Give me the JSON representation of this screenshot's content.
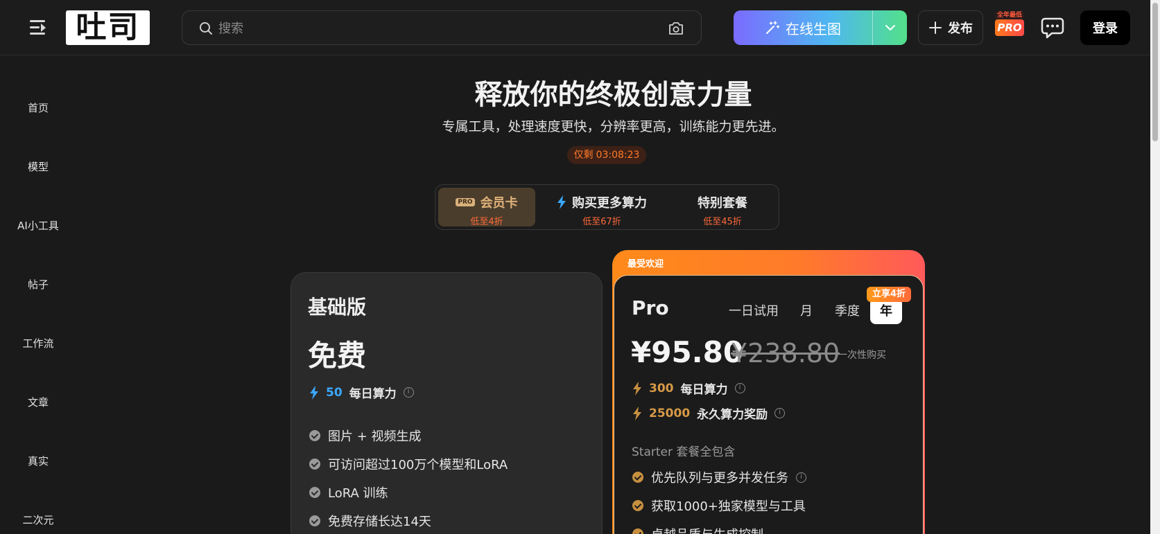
{
  "header": {
    "logo_text": "吐司",
    "search_placeholder": "搜索",
    "gen_button_label": "在线生图",
    "publish_label": "发布",
    "pro_badge_top": "全年最低",
    "pro_badge_label": "PRO",
    "login_label": "登录"
  },
  "sidebar": {
    "items": [
      "首页",
      "模型",
      "AI小工具",
      "帖子",
      "工作流",
      "文章",
      "真实",
      "二次元"
    ]
  },
  "hero": {
    "title": "释放你的终极创意力量",
    "subtitle": "专属工具，处理速度更快，分辨率更高，训练能力更先进。",
    "countdown_label": "仅剩",
    "countdown_value": "03:08:23"
  },
  "tabs": [
    {
      "title": "会员卡",
      "badge": "PRO",
      "sub": "低至4折"
    },
    {
      "title": "购买更多算力",
      "sub": "低至67折"
    },
    {
      "title": "特别套餐",
      "sub": "低至45折"
    }
  ],
  "basic": {
    "title": "基础版",
    "price": "免费",
    "credits_value": "50",
    "credits_label": "每日算力",
    "features": [
      "图片 + 视频生成",
      "可访问超过100万个模型和LoRA",
      "LoRA 训练",
      "免费存储长达14天"
    ]
  },
  "pro": {
    "ribbon": "最受欢迎",
    "title": "Pro",
    "periods": [
      "一日试用",
      "月",
      "季度",
      "年"
    ],
    "discount_badge": "立享4折",
    "price": "¥95.80",
    "old_price": "¥238.80",
    "once_label": "一次性购买",
    "daily_credits_value": "300",
    "daily_credits_label": "每日算力",
    "bonus_credits_value": "25000",
    "bonus_credits_label": "永久算力奖励",
    "includes_label": "Starter 套餐全包含",
    "features": [
      "优先队列与更多并发任务",
      "获取1000+独家模型与工具",
      "卓越品质与生成控制"
    ]
  },
  "colors": {
    "accent_orange": "#ff7a2a",
    "blue": "#3aa8ff",
    "gold": "#d79a47"
  }
}
